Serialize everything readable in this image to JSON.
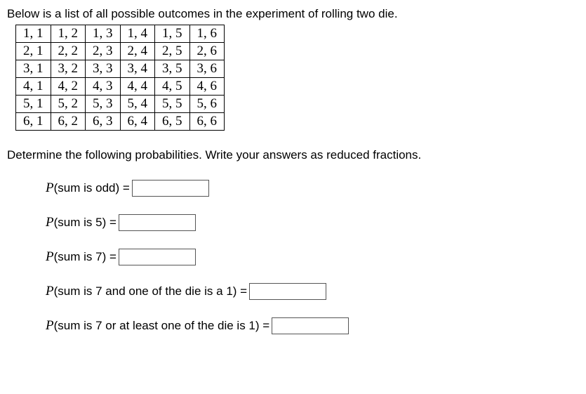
{
  "intro": "Below is a list of all possible outcomes in the experiment of rolling two die.",
  "table_rows": [
    [
      "1, 1",
      "1, 2",
      "1, 3",
      "1, 4",
      "1, 5",
      "1, 6"
    ],
    [
      "2, 1",
      "2, 2",
      "2, 3",
      "2, 4",
      "2, 5",
      "2, 6"
    ],
    [
      "3, 1",
      "3, 2",
      "3, 3",
      "3, 4",
      "3, 5",
      "3, 6"
    ],
    [
      "4, 1",
      "4, 2",
      "4, 3",
      "4, 4",
      "4, 5",
      "4, 6"
    ],
    [
      "5, 1",
      "5, 2",
      "5, 3",
      "5, 4",
      "5, 5",
      "5, 6"
    ],
    [
      "6, 1",
      "6, 2",
      "6, 3",
      "6, 4",
      "6, 5",
      "6, 6"
    ]
  ],
  "instruction": "Determine the following probabilities. Write your answers as reduced fractions.",
  "questions": {
    "q1": {
      "p": "P",
      "open": "(",
      "text": "sum is odd",
      "close": ")",
      "eq": " = "
    },
    "q2": {
      "p": "P",
      "open": "(",
      "text": "sum is 5",
      "close": ")",
      "eq": " = "
    },
    "q3": {
      "p": "P",
      "open": "(",
      "text": "sum is 7",
      "close": ")",
      "eq": " = "
    },
    "q4": {
      "p": "P",
      "open": "(",
      "text": "sum is 7 and one of the die is a 1",
      "close": ")",
      "eq": " = "
    },
    "q5": {
      "p": "P",
      "open": "(",
      "text": "sum is 7 or at least one of the die is 1",
      "close": ")",
      "eq": " = "
    }
  }
}
